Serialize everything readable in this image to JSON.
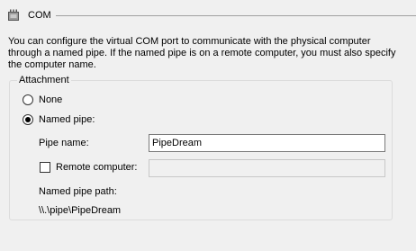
{
  "header": {
    "title": "COM",
    "icon": "serial-port-icon"
  },
  "description": "You can configure the virtual COM port to communicate with the physical computer through a named pipe. If the named pipe is on a remote computer, you must also specify the computer name.",
  "attachment": {
    "legend": "Attachment",
    "options": {
      "none": "None",
      "named_pipe": "Named pipe:"
    },
    "selected": "named_pipe",
    "pipe_name_label": "Pipe name:",
    "pipe_name_value": "PipeDream",
    "remote_computer_label": "Remote computer:",
    "remote_computer_value": "",
    "remote_computer_checked": false,
    "named_pipe_path_label": "Named pipe path:",
    "named_pipe_path_value": "\\\\.\\pipe\\PipeDream"
  }
}
